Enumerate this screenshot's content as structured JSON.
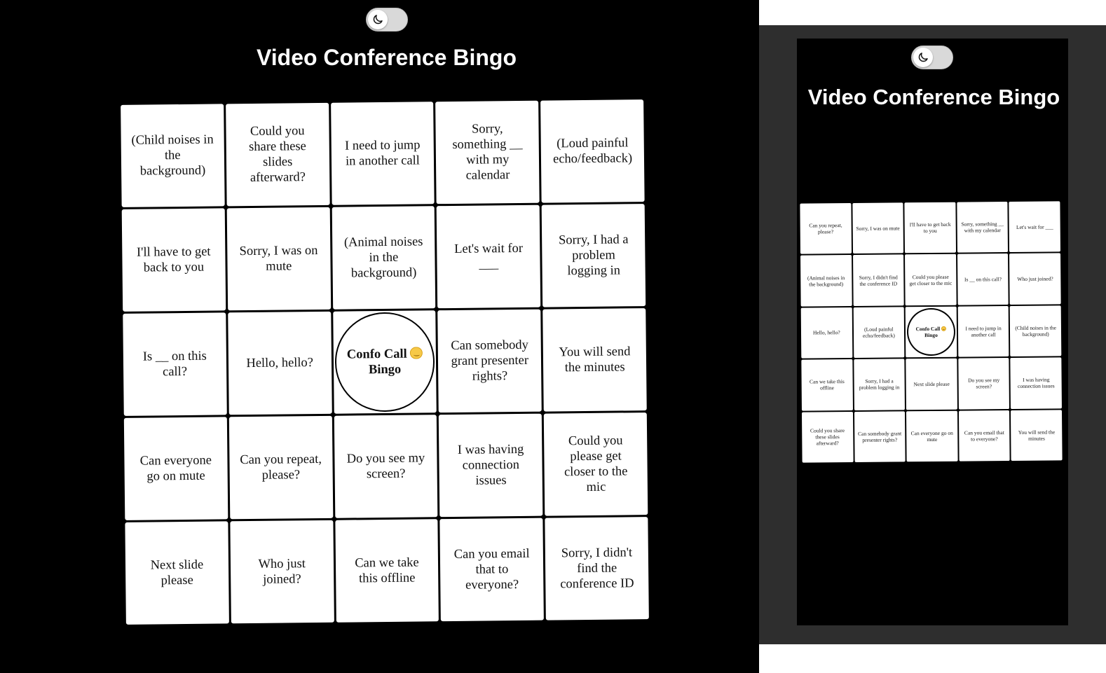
{
  "page": {
    "title": "Video Conference Bingo",
    "theme_toggle_icon": "moon-icon",
    "colors": {
      "background": "#000000",
      "cell": "#ffffff",
      "cell_text": "#111111",
      "frame": "#2e2e2e"
    }
  },
  "desktop": {
    "cells": [
      "(Child noises in the background)",
      "Could you share these slides afterward?",
      "I need to jump in another call",
      "Sorry, something __ with my calendar",
      "(Loud painful echo/feedback)",
      "I'll have to get back to you",
      "Sorry, I was on mute",
      "(Animal noises in the background)",
      "Let's wait for ___",
      "Sorry, I had a problem logging in",
      "Is __ on this call?",
      "Hello, hello?",
      "Confo Call",
      "Can somebody grant presenter rights?",
      "You will send the minutes",
      "Can everyone go on mute",
      "Can you repeat, please?",
      "Do you see my screen?",
      "I was having connection issues",
      "Could you please get closer to the mic",
      "Next slide please",
      "Who just joined?",
      "Can we take this offline",
      "Can you email that to everyone?",
      "Sorry, I didn't find the conference ID"
    ],
    "center_label_line2": "Bingo"
  },
  "mobile": {
    "cells": [
      "Can you repeat, please?",
      "Sorry, I was on mute",
      "I'll have to get back to you",
      "Sorry, something __ with my calendar",
      "Let's wait for ___",
      "(Animal noises in the background)",
      "Sorry, I didn't find the conference ID",
      "Could you please get closer to the mic",
      "Is __ on this call?",
      "Who just joined?",
      "Hello, hello?",
      "(Loud painful echo/feedback)",
      "Confo Call",
      "I need to jump in another call",
      "(Child noises in the background)",
      "Can we take this offline",
      "Sorry, I had a problem logging in",
      "Next slide please",
      "Do you see my screen?",
      "I was having connection issues",
      "Could you share these slides afterward?",
      "Can somebody grant presenter rights?",
      "Can everyone go on mute",
      "Can you email that to everyone?",
      "You will send the minutes"
    ],
    "center_label_line2": "Bingo"
  }
}
